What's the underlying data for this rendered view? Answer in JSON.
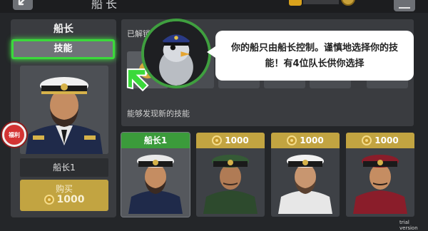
{
  "header": {
    "title": "船长",
    "back_icon": "back-arrow-icon",
    "menu_icon": "hamburger-menu-icon"
  },
  "left_panel": {
    "title": "船长",
    "tab_skills": "技能",
    "captain_name": "船长1",
    "buy_label": "购买",
    "buy_price": "1000",
    "badge_text": "福利"
  },
  "skills_panel": {
    "unlocked_label": "已解锁的技能",
    "discover_label": "能够发现新的技能",
    "slots": [
      {
        "state": "unlocked",
        "icon": "skill-icon"
      },
      {
        "state": "locked",
        "icon": "lock-icon"
      },
      {
        "state": "locked",
        "icon": "lock-icon"
      },
      {
        "state": "locked",
        "icon": "lock-icon"
      },
      {
        "state": "locked",
        "icon": "lock-icon"
      },
      {
        "state": "locked",
        "icon": "lock-icon"
      }
    ]
  },
  "tutorial": {
    "message": "你的船只由船长控制。谨慎地选择你的技能！有4位队长供你选择"
  },
  "captains": [
    {
      "label": "船长1",
      "selected": true,
      "coat": "#1f2a4a",
      "hat": "#e9e9e9"
    },
    {
      "label": "1000",
      "selected": false,
      "coat": "#2d4a2d",
      "hat": "#355a36"
    },
    {
      "label": "1000",
      "selected": false,
      "coat": "#e7e7e7",
      "hat": "#f2f2f2"
    },
    {
      "label": "1000",
      "selected": false,
      "coat": "#8a1d2a",
      "hat": "#8a1d2a"
    }
  ],
  "colors": {
    "accent_green": "#3bd93b",
    "gold": "#c2a441",
    "panel": "#3a3c40"
  },
  "watermark": "trial version"
}
